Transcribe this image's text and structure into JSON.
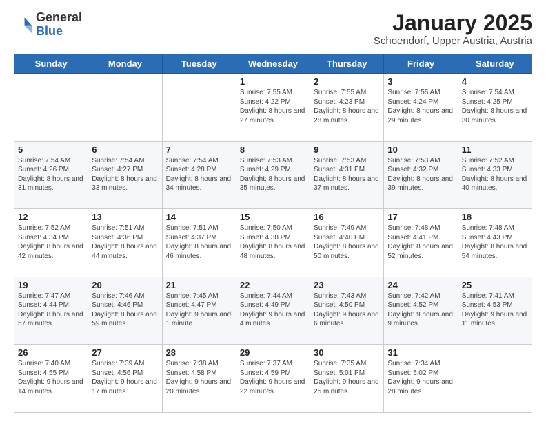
{
  "header": {
    "logo_general": "General",
    "logo_blue": "Blue",
    "title": "January 2025",
    "subtitle": "Schoendorf, Upper Austria, Austria"
  },
  "weekdays": [
    "Sunday",
    "Monday",
    "Tuesday",
    "Wednesday",
    "Thursday",
    "Friday",
    "Saturday"
  ],
  "weeks": [
    [
      {
        "day": "",
        "info": ""
      },
      {
        "day": "",
        "info": ""
      },
      {
        "day": "",
        "info": ""
      },
      {
        "day": "1",
        "info": "Sunrise: 7:55 AM\nSunset: 4:22 PM\nDaylight: 8 hours and 27 minutes."
      },
      {
        "day": "2",
        "info": "Sunrise: 7:55 AM\nSunset: 4:23 PM\nDaylight: 8 hours and 28 minutes."
      },
      {
        "day": "3",
        "info": "Sunrise: 7:55 AM\nSunset: 4:24 PM\nDaylight: 8 hours and 29 minutes."
      },
      {
        "day": "4",
        "info": "Sunrise: 7:54 AM\nSunset: 4:25 PM\nDaylight: 8 hours and 30 minutes."
      }
    ],
    [
      {
        "day": "5",
        "info": "Sunrise: 7:54 AM\nSunset: 4:26 PM\nDaylight: 8 hours and 31 minutes."
      },
      {
        "day": "6",
        "info": "Sunrise: 7:54 AM\nSunset: 4:27 PM\nDaylight: 8 hours and 33 minutes."
      },
      {
        "day": "7",
        "info": "Sunrise: 7:54 AM\nSunset: 4:28 PM\nDaylight: 8 hours and 34 minutes."
      },
      {
        "day": "8",
        "info": "Sunrise: 7:53 AM\nSunset: 4:29 PM\nDaylight: 8 hours and 35 minutes."
      },
      {
        "day": "9",
        "info": "Sunrise: 7:53 AM\nSunset: 4:31 PM\nDaylight: 8 hours and 37 minutes."
      },
      {
        "day": "10",
        "info": "Sunrise: 7:53 AM\nSunset: 4:32 PM\nDaylight: 8 hours and 39 minutes."
      },
      {
        "day": "11",
        "info": "Sunrise: 7:52 AM\nSunset: 4:33 PM\nDaylight: 8 hours and 40 minutes."
      }
    ],
    [
      {
        "day": "12",
        "info": "Sunrise: 7:52 AM\nSunset: 4:34 PM\nDaylight: 8 hours and 42 minutes."
      },
      {
        "day": "13",
        "info": "Sunrise: 7:51 AM\nSunset: 4:36 PM\nDaylight: 8 hours and 44 minutes."
      },
      {
        "day": "14",
        "info": "Sunrise: 7:51 AM\nSunset: 4:37 PM\nDaylight: 8 hours and 46 minutes."
      },
      {
        "day": "15",
        "info": "Sunrise: 7:50 AM\nSunset: 4:38 PM\nDaylight: 8 hours and 48 minutes."
      },
      {
        "day": "16",
        "info": "Sunrise: 7:49 AM\nSunset: 4:40 PM\nDaylight: 8 hours and 50 minutes."
      },
      {
        "day": "17",
        "info": "Sunrise: 7:48 AM\nSunset: 4:41 PM\nDaylight: 8 hours and 52 minutes."
      },
      {
        "day": "18",
        "info": "Sunrise: 7:48 AM\nSunset: 4:43 PM\nDaylight: 8 hours and 54 minutes."
      }
    ],
    [
      {
        "day": "19",
        "info": "Sunrise: 7:47 AM\nSunset: 4:44 PM\nDaylight: 8 hours and 57 minutes."
      },
      {
        "day": "20",
        "info": "Sunrise: 7:46 AM\nSunset: 4:46 PM\nDaylight: 8 hours and 59 minutes."
      },
      {
        "day": "21",
        "info": "Sunrise: 7:45 AM\nSunset: 4:47 PM\nDaylight: 9 hours and 1 minute."
      },
      {
        "day": "22",
        "info": "Sunrise: 7:44 AM\nSunset: 4:49 PM\nDaylight: 9 hours and 4 minutes."
      },
      {
        "day": "23",
        "info": "Sunrise: 7:43 AM\nSunset: 4:50 PM\nDaylight: 9 hours and 6 minutes."
      },
      {
        "day": "24",
        "info": "Sunrise: 7:42 AM\nSunset: 4:52 PM\nDaylight: 9 hours and 9 minutes."
      },
      {
        "day": "25",
        "info": "Sunrise: 7:41 AM\nSunset: 4:53 PM\nDaylight: 9 hours and 11 minutes."
      }
    ],
    [
      {
        "day": "26",
        "info": "Sunrise: 7:40 AM\nSunset: 4:55 PM\nDaylight: 9 hours and 14 minutes."
      },
      {
        "day": "27",
        "info": "Sunrise: 7:39 AM\nSunset: 4:56 PM\nDaylight: 9 hours and 17 minutes."
      },
      {
        "day": "28",
        "info": "Sunrise: 7:38 AM\nSunset: 4:58 PM\nDaylight: 9 hours and 20 minutes."
      },
      {
        "day": "29",
        "info": "Sunrise: 7:37 AM\nSunset: 4:59 PM\nDaylight: 9 hours and 22 minutes."
      },
      {
        "day": "30",
        "info": "Sunrise: 7:35 AM\nSunset: 5:01 PM\nDaylight: 9 hours and 25 minutes."
      },
      {
        "day": "31",
        "info": "Sunrise: 7:34 AM\nSunset: 5:02 PM\nDaylight: 9 hours and 28 minutes."
      },
      {
        "day": "",
        "info": ""
      }
    ]
  ]
}
